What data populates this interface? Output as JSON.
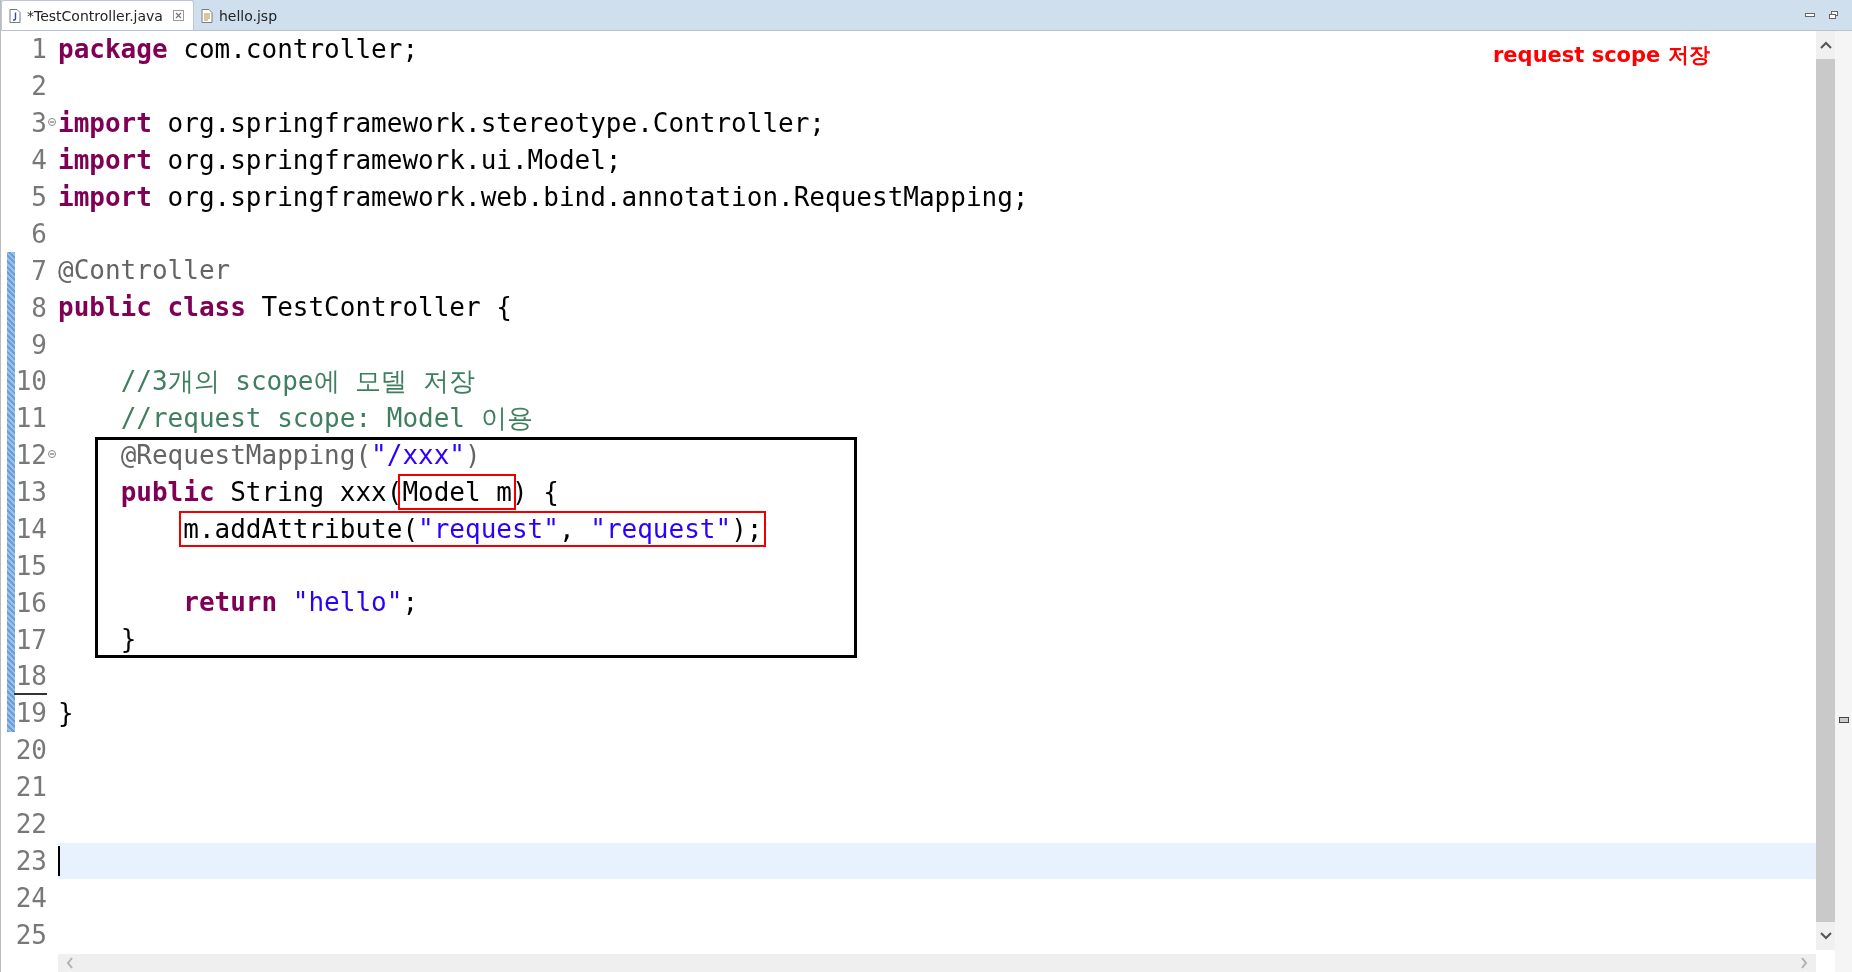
{
  "tabs": [
    {
      "label": "*TestController.java",
      "selected": true,
      "kind": "java",
      "closable": true
    },
    {
      "label": "hello.jsp",
      "selected": false,
      "kind": "jsp",
      "closable": false
    }
  ],
  "note": "request scope 저장",
  "lines": [
    {
      "kind": "line",
      "number": "1",
      "tokens": [
        {
          "text": "package",
          "kind": "keyword"
        },
        {
          "text": " com.controller;",
          "kind": "plain"
        }
      ]
    },
    {
      "kind": "line",
      "number": "2"
    },
    {
      "kind": "fold",
      "number": "3",
      "tokens": [
        {
          "text": "import",
          "kind": "keyword"
        },
        {
          "text": " org.springframework.stereotype.Controller;",
          "kind": "plain"
        }
      ]
    },
    {
      "kind": "line",
      "number": "4",
      "tokens": [
        {
          "text": "import",
          "kind": "keyword"
        },
        {
          "text": " org.springframework.ui.Model;",
          "kind": "plain"
        }
      ]
    },
    {
      "kind": "line",
      "number": "5",
      "tokens": [
        {
          "text": "import",
          "kind": "keyword"
        },
        {
          "text": " org.springframework.web.bind.annotation.RequestMapping;",
          "kind": "plain"
        }
      ]
    },
    {
      "kind": "line",
      "number": "6"
    },
    {
      "kind": "changed",
      "children": [
        {
          "kind": "line",
          "number": "7",
          "tokens": [
            {
              "text": "@Controller",
              "kind": "annotation"
            }
          ]
        },
        {
          "kind": "line",
          "number": "8",
          "tokens": [
            {
              "text": "public class",
              "kind": "keyword"
            },
            {
              "text": " TestController {",
              "kind": "plain"
            }
          ]
        },
        {
          "kind": "line",
          "number": "9"
        },
        {
          "kind": "line",
          "number": "10",
          "tokens": [
            {
              "text": "    //3개의 scope에 모델 저장",
              "kind": "comment"
            }
          ]
        },
        {
          "kind": "line",
          "number": "11",
          "tokens": [
            {
              "text": "    //request scope: Model 이용",
              "kind": "comment"
            }
          ]
        },
        {
          "kind": "frame",
          "children": [
            {
              "kind": "fold",
              "number": "12",
              "tokens": [
                {
                  "text": "    @RequestMapping(",
                  "kind": "annotation"
                },
                {
                  "text": "\"/xxx\"",
                  "kind": "string"
                },
                {
                  "text": ")",
                  "kind": "annotation"
                }
              ]
            },
            {
              "kind": "line",
              "number": "13",
              "tokens": [
                {
                  "text": "    public",
                  "kind": "keyword"
                },
                {
                  "text": " String xxx(",
                  "kind": "plain"
                },
                {
                  "kind": "highlight",
                  "children": [
                    {
                      "text": "Model m",
                      "kind": "plain"
                    }
                  ]
                },
                {
                  "text": ") {",
                  "kind": "plain"
                }
              ]
            },
            {
              "kind": "line",
              "number": "14",
              "tokens": [
                {
                  "kind": "highlight",
                  "children": [
                    {
                      "text": "        m.addAttribute(",
                      "kind": "plain"
                    },
                    {
                      "text": "\"request\"",
                      "kind": "string"
                    },
                    {
                      "text": ", ",
                      "kind": "plain"
                    },
                    {
                      "text": "\"request\"",
                      "kind": "string"
                    },
                    {
                      "text": ");",
                      "kind": "plain"
                    }
                  ]
                }
              ]
            },
            {
              "kind": "line",
              "number": "15"
            },
            {
              "kind": "line",
              "number": "16",
              "tokens": [
                {
                  "text": "        return",
                  "kind": "keyword"
                },
                {
                  "text": " \"hello\"",
                  "kind": "string"
                },
                {
                  "text": ";",
                  "kind": "plain"
                }
              ]
            },
            {
              "kind": "line",
              "number": "17",
              "tokens": [
                {
                  "text": "    }",
                  "kind": "plain"
                }
              ]
            }
          ]
        },
        {
          "kind": "deleted_after",
          "number": "18"
        },
        {
          "kind": "line",
          "number": "19",
          "tokens": [
            {
              "text": "}",
              "kind": "plain"
            }
          ]
        }
      ]
    },
    {
      "kind": "line",
      "number": "20"
    },
    {
      "kind": "line",
      "number": "21"
    },
    {
      "kind": "line",
      "number": "22"
    },
    {
      "kind": "current",
      "number": "23"
    },
    {
      "kind": "line",
      "number": "24"
    },
    {
      "kind": "line",
      "number": "25"
    }
  ]
}
